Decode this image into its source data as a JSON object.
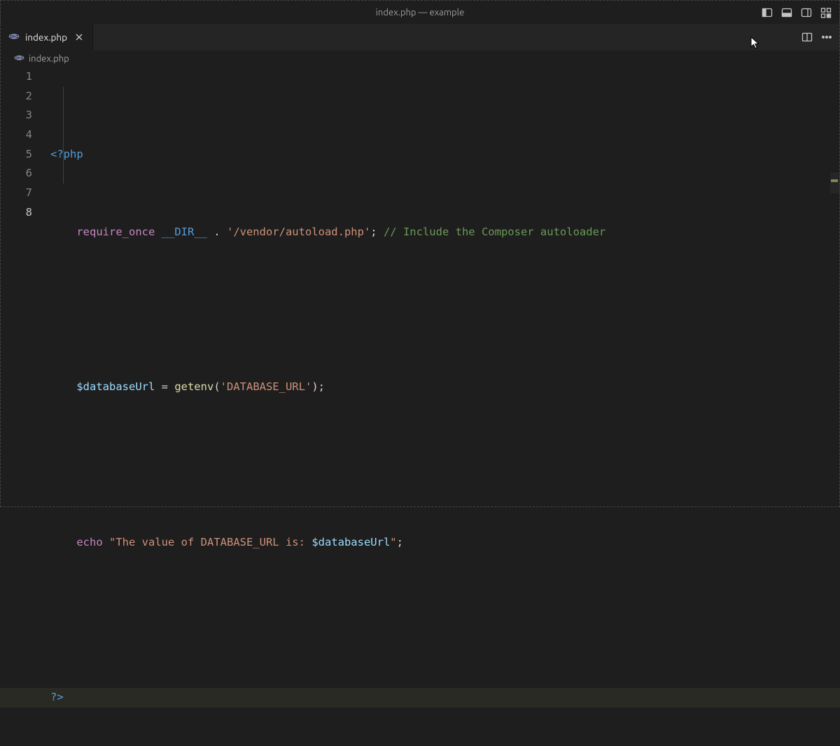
{
  "title": {
    "file": "index.php",
    "sep": " — ",
    "project": "example"
  },
  "tab": {
    "label": "index.php"
  },
  "breadcrumb": {
    "label": "index.php"
  },
  "code": {
    "line1": {
      "phptag": "<?php"
    },
    "line2": {
      "kw": "require_once",
      "const": "__DIR__",
      "dot": " . ",
      "str": "'/vendor/autoload.php'",
      "semi": ";",
      "comment": " // Include the Composer autoloader"
    },
    "line4": {
      "var": "$databaseUrl",
      "eq": " = ",
      "func": "getenv",
      "open": "(",
      "str": "'DATABASE_URL'",
      "close": ")",
      "semi": ";"
    },
    "line6": {
      "kw": "echo",
      "sp": " ",
      "q1": "\"",
      "str1": "The value of DATABASE_URL is: ",
      "var": "$databaseUrl",
      "q2": "\"",
      "semi": ";"
    },
    "line8": {
      "phptag": "?>"
    },
    "linenos": [
      "1",
      "2",
      "3",
      "4",
      "5",
      "6",
      "7",
      "8"
    ]
  }
}
